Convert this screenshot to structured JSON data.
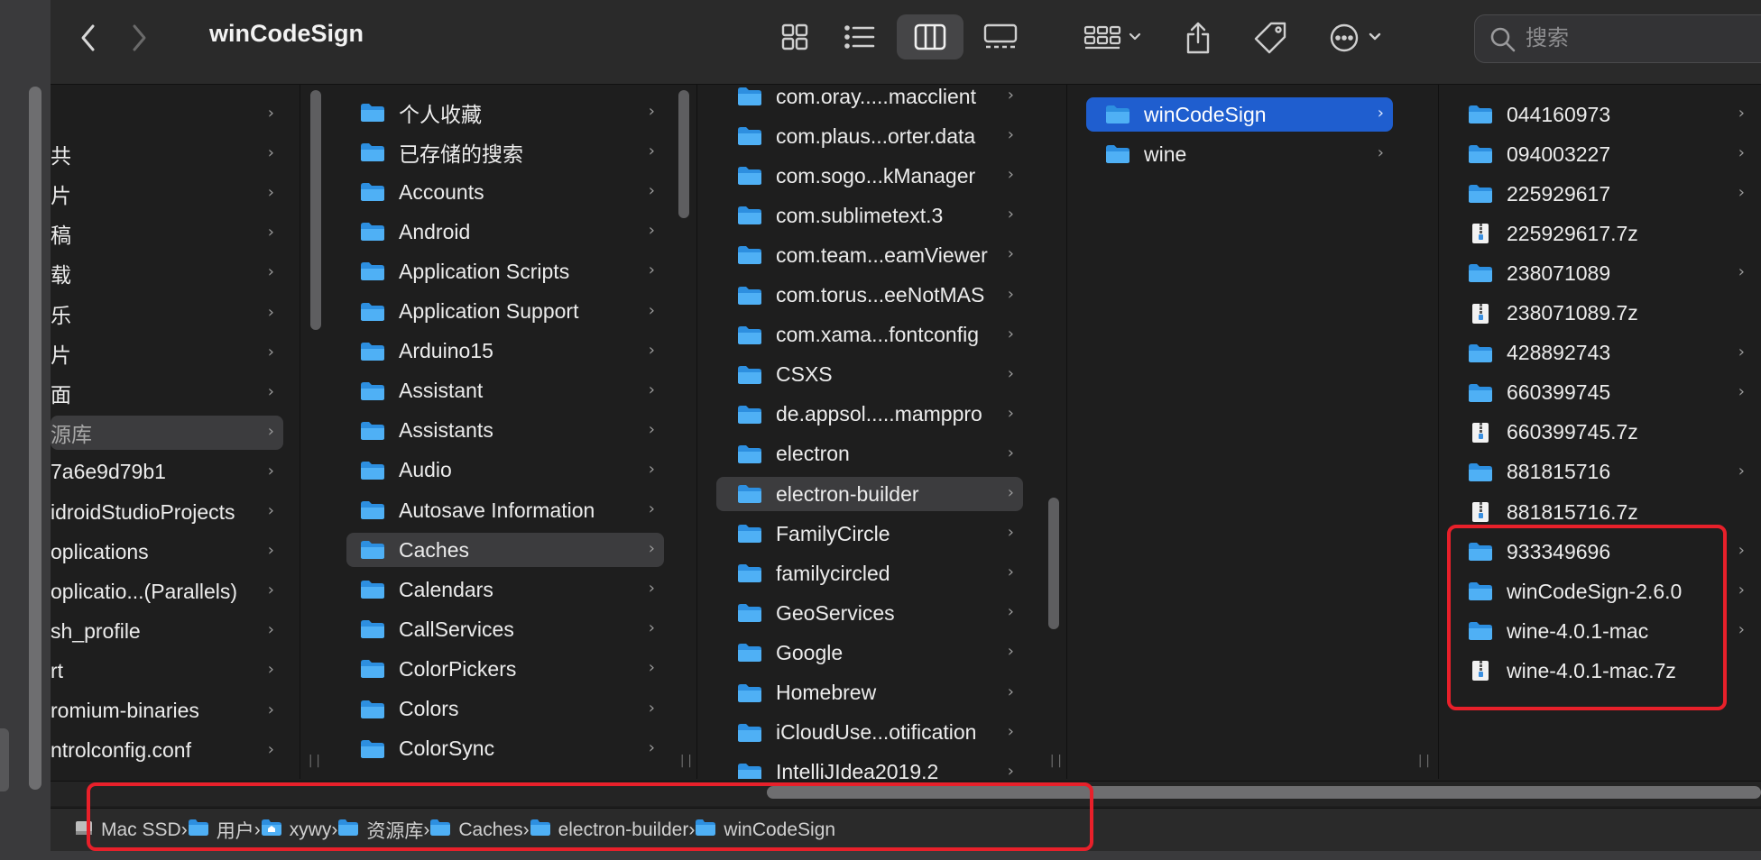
{
  "window": {
    "title": "winCodeSign"
  },
  "toolbar": {
    "back_icon": "chevron-left-icon",
    "forward_icon": "chevron-right-icon",
    "view_modes": [
      "icon-view",
      "list-view",
      "column-view",
      "gallery-view"
    ],
    "active_view": "column-view",
    "search_placeholder": "搜索"
  },
  "columns": {
    "sidebar": {
      "items": [
        {
          "label": ""
        },
        {
          "label": "共"
        },
        {
          "label": "片"
        },
        {
          "label": "稿"
        },
        {
          "label": "载"
        },
        {
          "label": "乐"
        },
        {
          "label": "片"
        },
        {
          "label": "面"
        },
        {
          "label": "源库"
        },
        {
          "label": "7a6e9d79b1"
        },
        {
          "label": "idroidStudioProjects"
        },
        {
          "label": "oplications"
        },
        {
          "label": "oplicatio...(Parallels)"
        },
        {
          "label": "sh_profile"
        },
        {
          "label": "rt"
        },
        {
          "label": "romium-binaries"
        },
        {
          "label": "ntrolconfig.conf"
        }
      ]
    },
    "library": {
      "items": [
        {
          "label": "个人收藏"
        },
        {
          "label": "已存储的搜索"
        },
        {
          "label": "Accounts"
        },
        {
          "label": "Android"
        },
        {
          "label": "Application Scripts"
        },
        {
          "label": "Application Support"
        },
        {
          "label": "Arduino15"
        },
        {
          "label": "Assistant"
        },
        {
          "label": "Assistants"
        },
        {
          "label": "Audio"
        },
        {
          "label": "Autosave Information"
        },
        {
          "label": "Caches"
        },
        {
          "label": "Calendars"
        },
        {
          "label": "CallServices"
        },
        {
          "label": "ColorPickers"
        },
        {
          "label": "Colors"
        },
        {
          "label": "ColorSync"
        }
      ]
    },
    "caches": {
      "items": [
        {
          "label": "com.oray.....macclient"
        },
        {
          "label": "com.plaus...orter.data"
        },
        {
          "label": "com.sogo...kManager"
        },
        {
          "label": "com.sublimetext.3"
        },
        {
          "label": "com.team...eamViewer"
        },
        {
          "label": "com.torus...eeNotMAS"
        },
        {
          "label": "com.xama...fontconfig"
        },
        {
          "label": "CSXS"
        },
        {
          "label": "de.appsol.....mamppro"
        },
        {
          "label": "electron"
        },
        {
          "label": "electron-builder"
        },
        {
          "label": "FamilyCircle"
        },
        {
          "label": "familycircled"
        },
        {
          "label": "GeoServices"
        },
        {
          "label": "Google"
        },
        {
          "label": "Homebrew"
        },
        {
          "label": "iCloudUse...otification"
        },
        {
          "label": "IntelliJIdea2019.2"
        }
      ]
    },
    "electron_builder": {
      "items": [
        {
          "label": "winCodeSign"
        },
        {
          "label": "wine"
        }
      ]
    },
    "wincodesign": {
      "items": [
        {
          "label": "044160973",
          "kind": "folder"
        },
        {
          "label": "094003227",
          "kind": "folder"
        },
        {
          "label": "225929617",
          "kind": "folder"
        },
        {
          "label": "225929617.7z",
          "kind": "archive"
        },
        {
          "label": "238071089",
          "kind": "folder"
        },
        {
          "label": "238071089.7z",
          "kind": "archive"
        },
        {
          "label": "428892743",
          "kind": "folder"
        },
        {
          "label": "660399745",
          "kind": "folder"
        },
        {
          "label": "660399745.7z",
          "kind": "archive"
        },
        {
          "label": "881815716",
          "kind": "folder"
        },
        {
          "label": "881815716.7z",
          "kind": "archive"
        },
        {
          "label": "933349696",
          "kind": "folder"
        },
        {
          "label": "winCodeSign-2.6.0",
          "kind": "folder"
        },
        {
          "label": "wine-4.0.1-mac",
          "kind": "folder"
        },
        {
          "label": "wine-4.0.1-mac.7z",
          "kind": "archive"
        }
      ]
    }
  },
  "pathbar": {
    "crumbs": [
      {
        "label": "Mac SSD",
        "icon": "disk-icon"
      },
      {
        "label": "用户",
        "icon": "folder-icon"
      },
      {
        "label": "xywy",
        "icon": "home-icon"
      },
      {
        "label": "资源库",
        "icon": "folder-icon"
      },
      {
        "label": "Caches",
        "icon": "folder-icon"
      },
      {
        "label": "electron-builder",
        "icon": "folder-icon"
      },
      {
        "label": "winCodeSign",
        "icon": "folder-icon"
      }
    ]
  },
  "colors": {
    "accent_blue": "#1f5ecf",
    "folder_blue": "#3aa0ef",
    "highlight_red": "#e8202a"
  }
}
